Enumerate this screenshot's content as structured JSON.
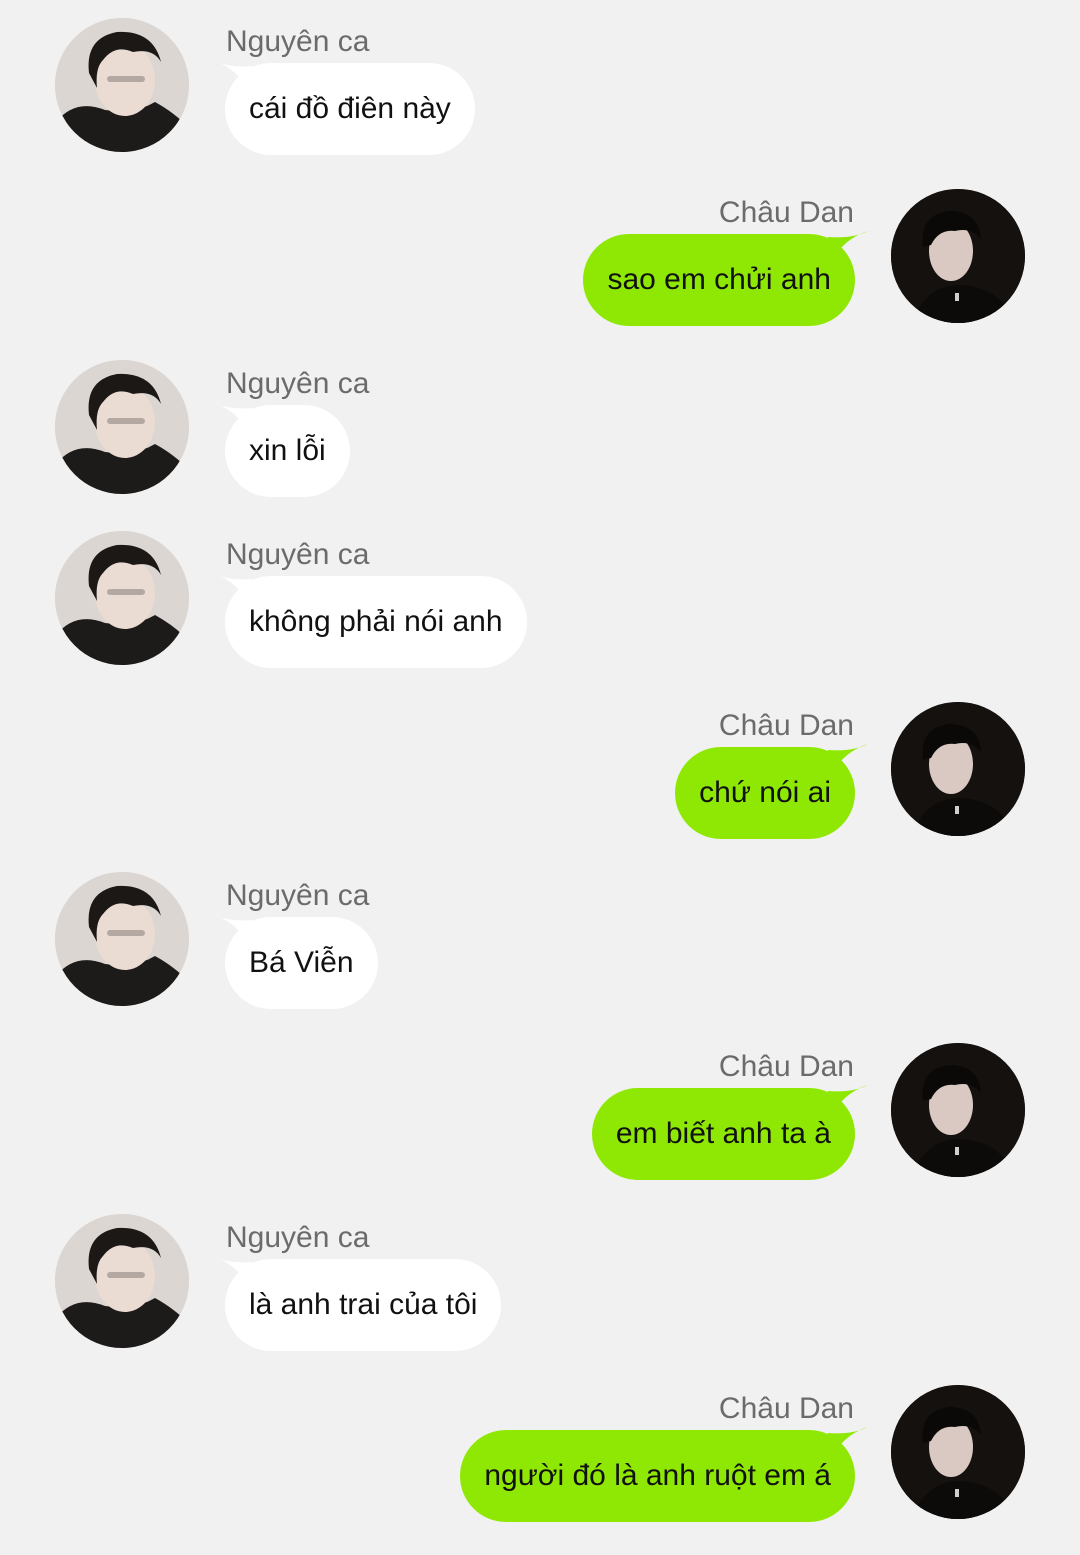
{
  "contacts": {
    "left": {
      "name": "Nguyên ca",
      "avatar_icon": "user-avatar-photo-icon"
    },
    "right": {
      "name": "Châu Dan",
      "avatar_icon": "user-avatar-photo-icon"
    }
  },
  "colors": {
    "background": "#f1f1f1",
    "incoming_bubble": "#ffffff",
    "outgoing_bubble": "#8fe803",
    "name_text": "#6b6b6b",
    "message_text": "#111111"
  },
  "messages": [
    {
      "side": "left",
      "sender": "Nguyên ca",
      "text": "cái đồ điên này"
    },
    {
      "side": "right",
      "sender": "Châu Dan",
      "text": "sao em chửi anh"
    },
    {
      "side": "left",
      "sender": "Nguyên ca",
      "text": "xin lỗi"
    },
    {
      "side": "left",
      "sender": "Nguyên ca",
      "text": "không phải nói anh"
    },
    {
      "side": "right",
      "sender": "Châu Dan",
      "text": "chứ nói ai"
    },
    {
      "side": "left",
      "sender": "Nguyên ca",
      "text": "Bá Viễn"
    },
    {
      "side": "right",
      "sender": "Châu Dan",
      "text": "em biết anh ta à"
    },
    {
      "side": "left",
      "sender": "Nguyên ca",
      "text": "là anh trai của tôi"
    },
    {
      "side": "right",
      "sender": "Châu Dan",
      "text": "người đó là anh ruột em á"
    }
  ]
}
